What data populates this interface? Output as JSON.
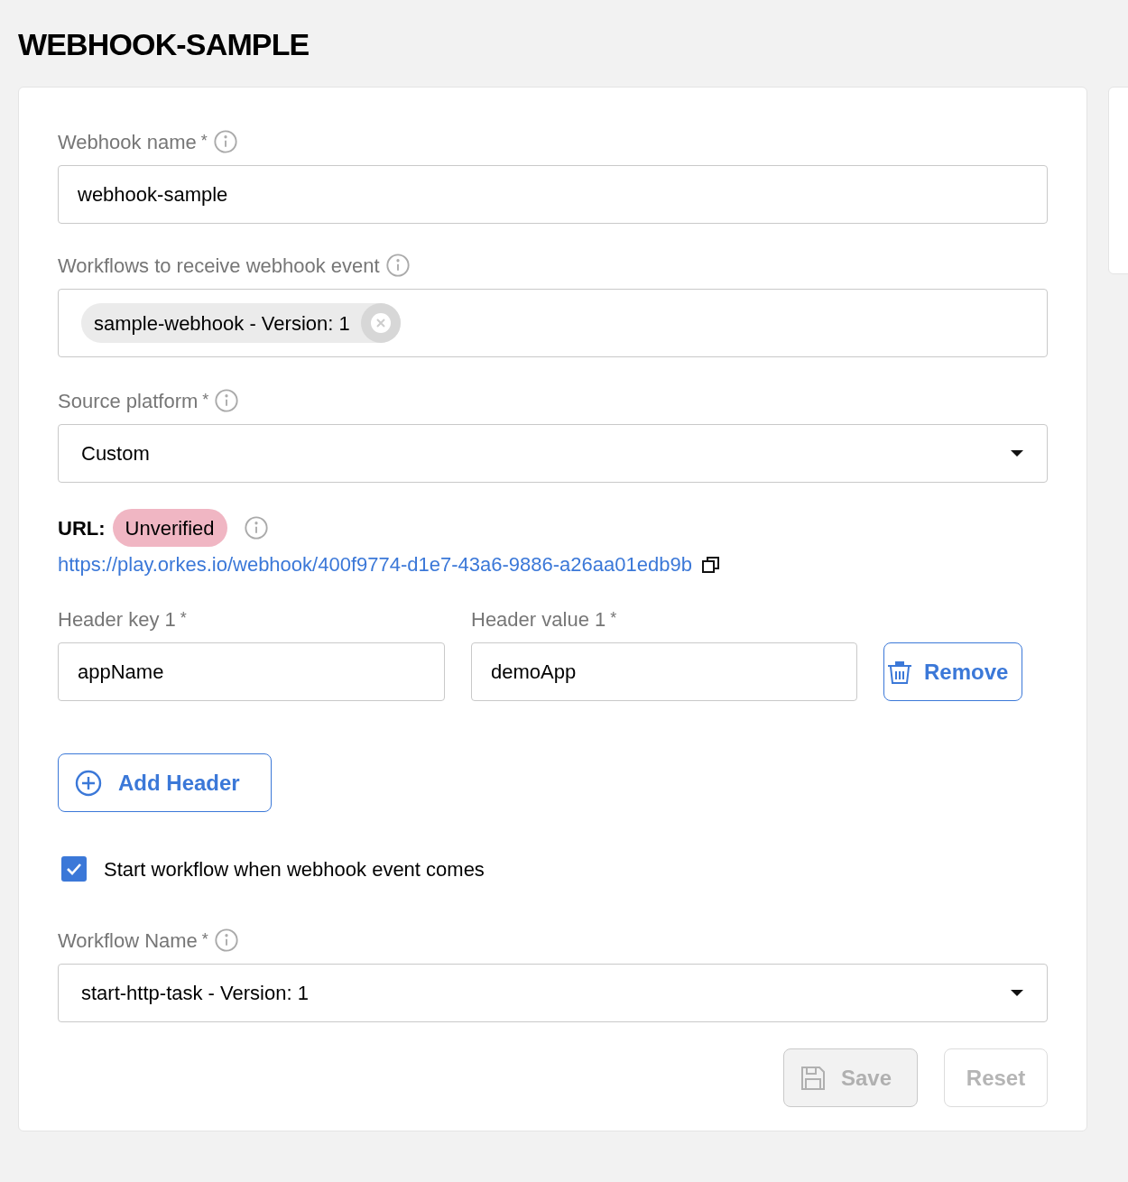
{
  "page_title": "WEBHOOK-SAMPLE",
  "webhook_name": {
    "label": "Webhook name",
    "required_mark": "*",
    "value": "webhook-sample"
  },
  "workflows": {
    "label": "Workflows to receive webhook event",
    "chips": [
      {
        "label": "sample-webhook - Version: 1"
      }
    ]
  },
  "source_platform": {
    "label": "Source platform",
    "required_mark": "*",
    "value": "Custom"
  },
  "url": {
    "label": "URL:",
    "status": "Unverified",
    "verified": false,
    "link": "https://play.orkes.io/webhook/400f9774-d1e7-43a6-9886-a26aa01edb9b"
  },
  "headers": [
    {
      "key_label": "Header key 1",
      "key_required_mark": "*",
      "key": "appName",
      "value_label": "Header value 1",
      "value_required_mark": "*",
      "value": "demoApp",
      "remove_button": "Remove"
    }
  ],
  "add_header_button": "Add Header",
  "start_workflow": {
    "label": "Start workflow when webhook event comes",
    "checked": true
  },
  "workflow_name": {
    "label": "Workflow Name",
    "required_mark": "*",
    "value": "start-http-task - Version: 1"
  },
  "buttons": [
    {
      "label": "Save",
      "kind": "save",
      "disabled": true
    },
    {
      "label": "Reset",
      "kind": "reset",
      "disabled": true
    }
  ]
}
